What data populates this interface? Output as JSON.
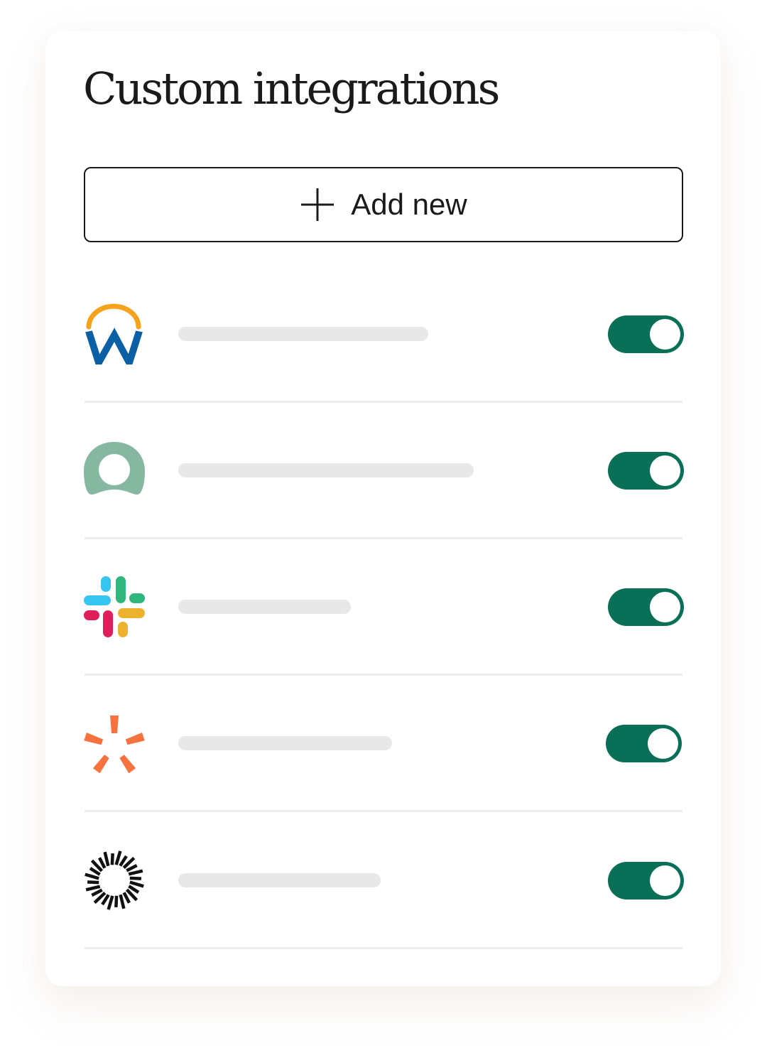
{
  "title": "Custom integrations",
  "add_button": {
    "label": "Add new",
    "icon": "plus-icon"
  },
  "integrations": [
    {
      "logo": "workday-logo-icon",
      "enabled": true
    },
    {
      "logo": "green-ring-logo-icon",
      "enabled": true
    },
    {
      "logo": "slack-logo-icon",
      "enabled": true
    },
    {
      "logo": "asana-star-logo-icon",
      "enabled": true
    },
    {
      "logo": "sunburst-logo-icon",
      "enabled": true
    }
  ],
  "colors": {
    "toggle_on": "#0a6f57",
    "placeholder": "#e8e8e8",
    "divider": "#ededed",
    "text": "#1a1a1a"
  }
}
